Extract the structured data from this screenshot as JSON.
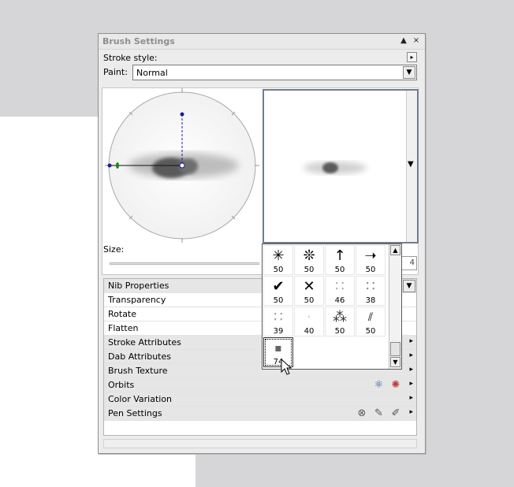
{
  "panel": {
    "title": "Brush Settings",
    "pin_symbol": "▲",
    "close_symbol": "×"
  },
  "stroke_style": {
    "label": "Stroke style:",
    "menu_symbol": "▸"
  },
  "paint": {
    "label": "Paint:",
    "value": "Normal",
    "arrow": "▼"
  },
  "size": {
    "label": "Size:",
    "value": "4"
  },
  "preview": {
    "arrow": "▼"
  },
  "properties": {
    "items": [
      {
        "label": "Nib Properties",
        "section": true
      },
      {
        "label": "Transparency",
        "section": false
      },
      {
        "label": "Rotate",
        "section": false
      },
      {
        "label": "Flatten",
        "section": false
      },
      {
        "label": "Stroke Attributes",
        "section": true
      },
      {
        "label": "Dab Attributes",
        "section": true
      },
      {
        "label": "Brush Texture",
        "section": true
      },
      {
        "label": "Orbits",
        "section": true
      },
      {
        "label": "Color Variation",
        "section": true
      },
      {
        "label": "Pen Settings",
        "section": true
      }
    ],
    "expand_symbol": "▸"
  },
  "nib_popup": {
    "up_symbol": "▲",
    "down_symbol": "▼",
    "nibs": [
      {
        "icon": "✳",
        "size": "50"
      },
      {
        "icon": "❊",
        "size": "50"
      },
      {
        "icon": "↑",
        "size": "50"
      },
      {
        "icon": "➝",
        "size": "50"
      },
      {
        "icon": "✔",
        "size": "50"
      },
      {
        "icon": "✕",
        "size": "50"
      },
      {
        "icon": "∷",
        "size": "46"
      },
      {
        "icon": "∷",
        "size": "38"
      },
      {
        "icon": "∷",
        "size": "39"
      },
      {
        "icon": "·",
        "size": "40"
      },
      {
        "icon": "⁂",
        "size": "50"
      },
      {
        "icon": "⫽",
        "size": "50"
      },
      {
        "icon": "▪",
        "size": "74"
      }
    ]
  },
  "colors": {
    "handle_blue": "#1a1aa8",
    "handle_green": "#168a16"
  }
}
